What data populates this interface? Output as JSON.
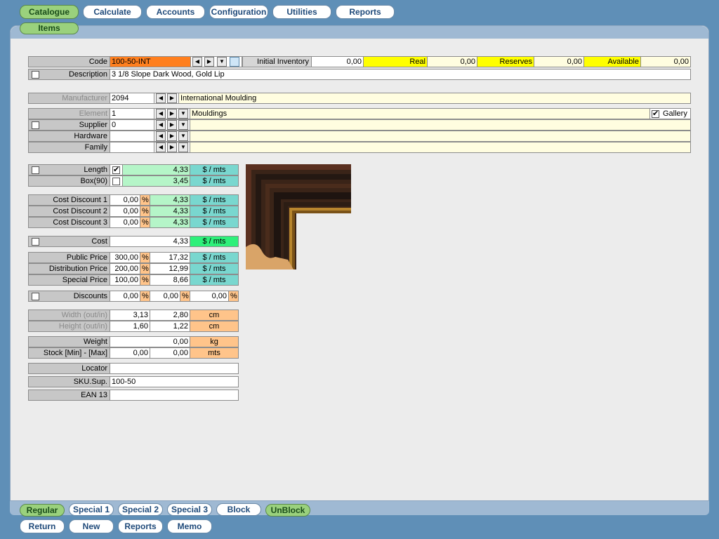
{
  "top_tabs": [
    "Catalogue",
    "Calculate",
    "Accounts",
    "Configuration",
    "Utilities",
    "Reports"
  ],
  "sub_tab": "Items",
  "code": {
    "label": "Code",
    "value": "100-50-INT",
    "initial_inventory_label": "Initial Inventory",
    "initial_inventory": "0,00",
    "real_label": "Real",
    "real": "0,00",
    "reserves_label": "Reserves",
    "reserves": "0,00",
    "available_label": "Available",
    "available": "0,00"
  },
  "description": {
    "label": "Description",
    "value": "3 1/8  Slope Dark Wood, Gold Lip"
  },
  "manufacturer": {
    "label": "Manufacturer",
    "code": "2094",
    "name": "International Moulding"
  },
  "element": {
    "label": "Element",
    "code": "1",
    "name": "Mouldings",
    "gallery_label": "Gallery"
  },
  "supplier": {
    "label": "Supplier",
    "code": "0"
  },
  "hardware": {
    "label": "Hardware"
  },
  "family": {
    "label": "Family"
  },
  "pricing": {
    "length": {
      "label": "Length",
      "value": "4,33",
      "unit": "$ / mts"
    },
    "box": {
      "label": "Box(90)",
      "value": "3,45",
      "unit": "$ / mts"
    },
    "cost_discounts": [
      {
        "label": "Cost Discount 1",
        "pct": "0,00",
        "value": "4,33",
        "unit": "$ / mts"
      },
      {
        "label": "Cost Discount 2",
        "pct": "0,00",
        "value": "4,33",
        "unit": "$ / mts"
      },
      {
        "label": "Cost Discount 3",
        "pct": "0,00",
        "value": "4,33",
        "unit": "$ / mts"
      }
    ],
    "cost": {
      "label": "Cost",
      "value": "4,33",
      "unit": "$ / mts"
    },
    "prices": [
      {
        "label": "Public Price",
        "pct": "300,00",
        "value": "17,32",
        "unit": "$ / mts"
      },
      {
        "label": "Distribution Price",
        "pct": "200,00",
        "value": "12,99",
        "unit": "$ / mts"
      },
      {
        "label": "Special Price",
        "pct": "100,00",
        "value": "8,66",
        "unit": "$ / mts"
      }
    ],
    "discounts": {
      "label": "Discounts",
      "d1": "0,00",
      "d2": "0,00",
      "d3": "0,00"
    },
    "percent_symbol": "%"
  },
  "dimensions": {
    "width": {
      "label": "Width (out/in)",
      "out": "3,13",
      "in": "2,80",
      "unit": "cm"
    },
    "height": {
      "label": "Height (out/in)",
      "out": "1,60",
      "in": "1,22",
      "unit": "cm"
    }
  },
  "weight": {
    "label": "Weight",
    "value": "0,00",
    "unit": "kg"
  },
  "stock": {
    "label": "Stock [Min] - [Max]",
    "min": "0,00",
    "max": "0,00",
    "unit": "mts"
  },
  "locator": {
    "label": "Locator",
    "value": ""
  },
  "sku": {
    "label": "SKU.Sup.",
    "value": "100-50"
  },
  "ean": {
    "label": "EAN 13",
    "value": ""
  },
  "bottom_tabs": [
    "Regular",
    "Special 1",
    "Special 2",
    "Special 3",
    "Block",
    "UnBlock"
  ],
  "actions": [
    "Return",
    "New",
    "Reports",
    "Memo"
  ]
}
